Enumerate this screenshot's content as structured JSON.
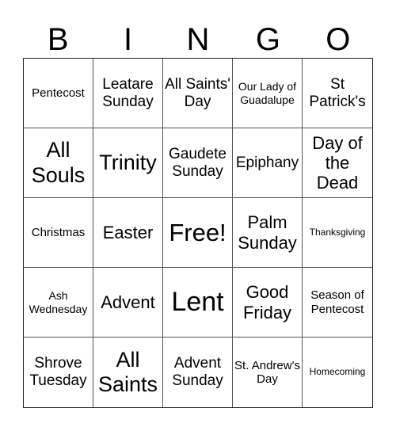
{
  "header": {
    "letters": [
      "B",
      "I",
      "N",
      "G",
      "O"
    ]
  },
  "grid": {
    "rows": [
      [
        {
          "text": "Pentecost",
          "size": "s-md"
        },
        {
          "text": "Leatare Sunday",
          "size": "s-lg"
        },
        {
          "text": "All Saints' Day",
          "size": "s-lg"
        },
        {
          "text": "Our Lady of Guadalupe",
          "size": "s-sm"
        },
        {
          "text": "St Patrick's",
          "size": "s-lg"
        }
      ],
      [
        {
          "text": "All Souls",
          "size": "s-xxl"
        },
        {
          "text": "Trinity",
          "size": "s-xxl"
        },
        {
          "text": "Gaudete Sunday",
          "size": "s-lg"
        },
        {
          "text": "Epiphany",
          "size": "s-lg"
        },
        {
          "text": "Day of the Dead",
          "size": "s-xl"
        }
      ],
      [
        {
          "text": "Christmas",
          "size": "s-md"
        },
        {
          "text": "Easter",
          "size": "s-xl"
        },
        {
          "text": "Free!",
          "size": "s-huge"
        },
        {
          "text": "Palm Sunday",
          "size": "s-xl"
        },
        {
          "text": "Thanksgiving",
          "size": "s-xs"
        }
      ],
      [
        {
          "text": "Ash Wednesday",
          "size": "s-sm"
        },
        {
          "text": "Advent",
          "size": "s-xl"
        },
        {
          "text": "Lent",
          "size": "s-giant"
        },
        {
          "text": "Good Friday",
          "size": "s-xl"
        },
        {
          "text": "Season of Pentecost",
          "size": "s-md"
        }
      ],
      [
        {
          "text": "Shrove Tuesday",
          "size": "s-lg"
        },
        {
          "text": "All Saints",
          "size": "s-xxl"
        },
        {
          "text": "Advent Sunday",
          "size": "s-lg"
        },
        {
          "text": "St. Andrew's Day",
          "size": "s-md"
        },
        {
          "text": "Homecoming",
          "size": "s-xs"
        }
      ]
    ]
  }
}
